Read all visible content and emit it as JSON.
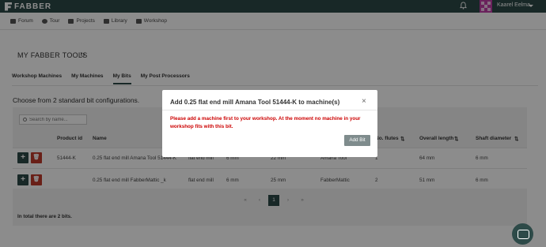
{
  "topbar": {
    "logo_text": "FABBER",
    "bell_icon": "bell-icon",
    "user_name": "Kaarel Eelma"
  },
  "nav": {
    "items": [
      {
        "label": "Forum",
        "icon": "forum-icon"
      },
      {
        "label": "Tour",
        "icon": "tour-icon"
      },
      {
        "label": "Projects",
        "icon": "folder-icon"
      },
      {
        "label": "Library",
        "icon": "book-icon"
      },
      {
        "label": "Workshop",
        "icon": "workshop-icon"
      }
    ]
  },
  "page": {
    "title": "MY FABBER TOOLS",
    "refresh_icon": "↻"
  },
  "tabs": [
    {
      "label": "Workshop Machines",
      "active": false
    },
    {
      "label": "My Machines",
      "active": false
    },
    {
      "label": "My Bits",
      "active": true
    },
    {
      "label": "My Post Processors",
      "active": false
    }
  ],
  "content": {
    "choose_text": "Choose from 2 standard bit configurations.",
    "search_placeholder": "Search by name...",
    "total_text": "In total there are 2 bits."
  },
  "table": {
    "columns": {
      "product_id": "Product id",
      "name": "Name",
      "flutes": "No. flutes",
      "overall_length": "Overall length",
      "shaft_diameter": "Shaft diameter"
    },
    "sort_icon": "⇅",
    "rows": [
      {
        "product_id": "51444-K",
        "name": "0.25 flat end mill Amana Tool 51444-K",
        "type": "flat end mill",
        "diameter": "6 mm",
        "length": "22 mm",
        "maker": "Amana Tool",
        "flutes": "1",
        "overall_length": "64 mm",
        "shaft_diameter": "6 mm"
      },
      {
        "product_id": "",
        "name": "0.25 flat end mill FabberMattic _k",
        "type": "flat end mill",
        "diameter": "6 mm",
        "length": "25 mm",
        "maker": "FabberMattic",
        "flutes": "2",
        "overall_length": "51 mm",
        "shaft_diameter": "6 mm"
      }
    ]
  },
  "pagination": {
    "first": "«",
    "prev": "‹",
    "current": "1",
    "next": "›",
    "last": "»"
  },
  "modal": {
    "title": "Add 0.25 flat end mill Amana Tool 51444-K to machine(s)",
    "close": "×",
    "message": "Please add a machine first to your workshop. At the moment no machine in your workshop fits with this bit.",
    "button": "Add Bit"
  },
  "colors": {
    "brand": "#2d4a48",
    "danger": "#c0392b",
    "error_text": "#cc0000",
    "avatar": "#c23fa8"
  }
}
